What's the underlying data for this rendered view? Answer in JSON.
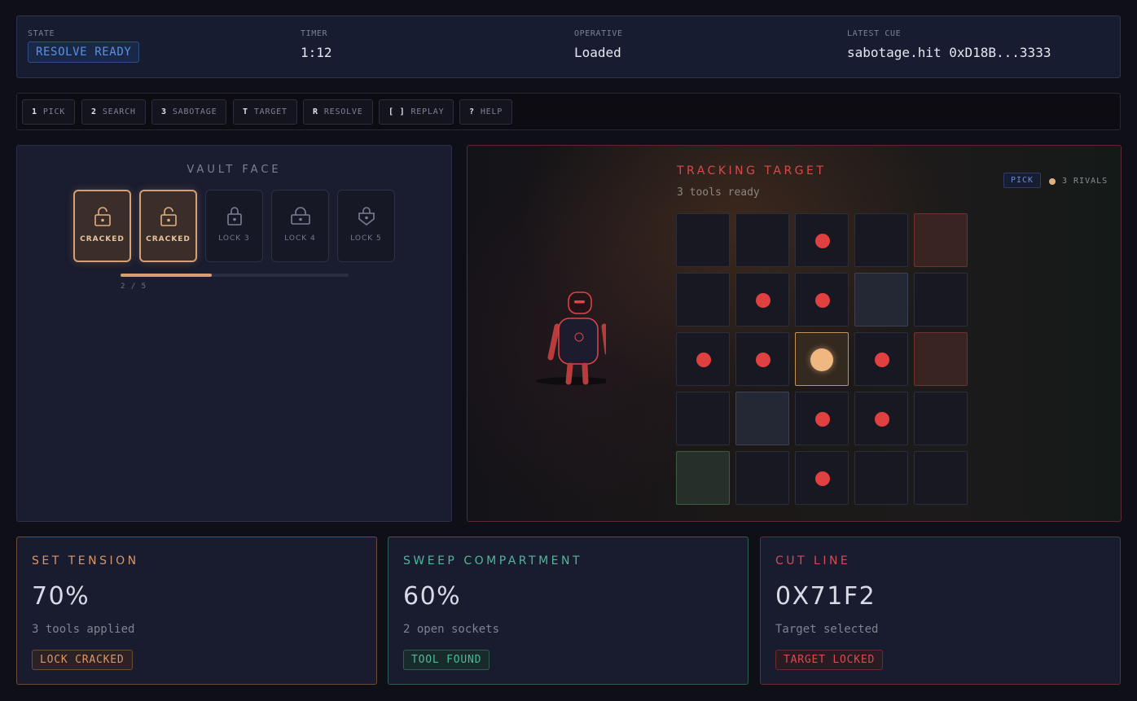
{
  "status": {
    "state_label": "STATE",
    "state_value": "RESOLVE READY",
    "timer_label": "TIMER",
    "timer_value": "1:12",
    "operative_label": "OPERATIVE",
    "operative_value": "Loaded",
    "cue_label": "LATEST CUE",
    "cue_value": "sabotage.hit 0xD18B...3333"
  },
  "toolbar": [
    {
      "key": "1",
      "label": "PICK"
    },
    {
      "key": "2",
      "label": "SEARCH"
    },
    {
      "key": "3",
      "label": "SABOTAGE"
    },
    {
      "key": "T",
      "label": "TARGET"
    },
    {
      "key": "R",
      "label": "RESOLVE"
    },
    {
      "key": "[ ]",
      "label": "REPLAY"
    },
    {
      "key": "?",
      "label": "HELP"
    }
  ],
  "vault": {
    "title": "VAULT FACE",
    "locks": [
      {
        "label": "CRACKED",
        "status": "cracked",
        "icon": "lock-open-icon"
      },
      {
        "label": "CRACKED",
        "status": "cracked",
        "icon": "lock-open-icon"
      },
      {
        "label": "LOCK 3",
        "status": "locked",
        "icon": "lock-closed-icon"
      },
      {
        "label": "LOCK 4",
        "status": "locked",
        "icon": "lock-closed-icon"
      },
      {
        "label": "LOCK 5",
        "status": "locked",
        "icon": "shield-lock-icon"
      }
    ],
    "progress_text": "2 / 5",
    "progress_fraction": 0.4
  },
  "scene": {
    "title": "TRACKING TARGET",
    "subtitle": "3 tools ready",
    "mode_badge": "PICK",
    "rivals_text": "3 RIVALS",
    "grid": [
      [
        "empty",
        "empty",
        "red",
        "empty",
        "hl-red"
      ],
      [
        "empty",
        "red",
        "red",
        "hl-blue",
        "empty"
      ],
      [
        "red",
        "red",
        "player",
        "red",
        "hl-red"
      ],
      [
        "empty",
        "hl-blue",
        "red",
        "red",
        "empty"
      ],
      [
        "hl-green",
        "empty",
        "red",
        "empty",
        "empty"
      ]
    ]
  },
  "metrics": [
    {
      "title": "SET TENSION",
      "value": "70%",
      "sub": "3 tools applied",
      "badge": "LOCK CRACKED",
      "color": "#d9966a",
      "badge_bg": "#2c2226",
      "badge_border": "#6e4a38"
    },
    {
      "title": "SWEEP COMPARTMENT",
      "value": "60%",
      "sub": "2 open sockets",
      "badge": "TOOL FOUND",
      "color": "#4fb89a",
      "badge_bg": "#182a2c",
      "badge_border": "#2c5e52"
    },
    {
      "title": "CUT LINE",
      "value": "0X71F2",
      "sub": "Target selected",
      "badge": "TARGET LOCKED",
      "color": "#d94a52",
      "badge_bg": "#2a1a22",
      "badge_border": "#6a2a32"
    }
  ]
}
